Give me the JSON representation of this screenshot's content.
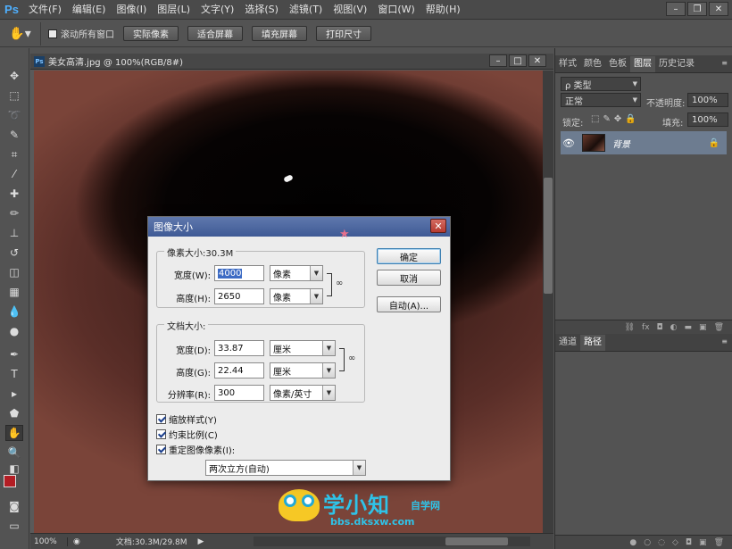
{
  "menubar": {
    "logo": "Ps",
    "items": [
      "文件(F)",
      "编辑(E)",
      "图像(I)",
      "图层(L)",
      "文字(Y)",
      "选择(S)",
      "滤镜(T)",
      "视图(V)",
      "窗口(W)",
      "帮助(H)"
    ]
  },
  "options": {
    "scroll_all_label": "滚动所有窗口",
    "buttons": [
      "实际像素",
      "适合屏幕",
      "填充屏幕",
      "打印尺寸"
    ]
  },
  "document": {
    "title": "美女高清.jpg @ 100%(RGB/8#)",
    "zoom": "100%",
    "doc_size": "文档:30.3M/29.8M"
  },
  "panels": {
    "top_tabs": [
      "样式",
      "颜色",
      "色板",
      "图层",
      "历史记录"
    ],
    "active_top_tab": "图层",
    "kind_label": "ρ 类型",
    "blend_mode": "正常",
    "opacity_label": "不透明度:",
    "opacity_value": "100%",
    "lock_label": "锁定:",
    "fill_label": "填充:",
    "fill_value": "100%",
    "layer_name": "背景",
    "bottom_tabs": [
      "通道",
      "路径"
    ],
    "active_bottom_tab": "路径"
  },
  "dialog": {
    "title": "图像大小",
    "pixel_group_title": "像素大小:30.3M",
    "width_label": "宽度(W):",
    "width_value": "4000",
    "width_unit": "像素",
    "height_label": "高度(H):",
    "height_value": "2650",
    "height_unit": "像素",
    "doc_group_title": "文档大小:",
    "doc_width_label": "宽度(D):",
    "doc_width_value": "33.87",
    "doc_width_unit": "厘米",
    "doc_height_label": "高度(G):",
    "doc_height_value": "22.44",
    "doc_height_unit": "厘米",
    "resolution_label": "分辨率(R):",
    "resolution_value": "300",
    "resolution_unit": "像素/英寸",
    "scale_styles_label": "缩放样式(Y)",
    "constrain_label": "约束比例(C)",
    "resample_label": "重定图像像素(I):",
    "resample_method": "两次立方(自动)",
    "ok_label": "确定",
    "cancel_label": "取消",
    "auto_label": "自动(A)..."
  },
  "watermark": {
    "main": "学小知",
    "sub": "自学网",
    "url": "bbs.dksxw.com"
  }
}
